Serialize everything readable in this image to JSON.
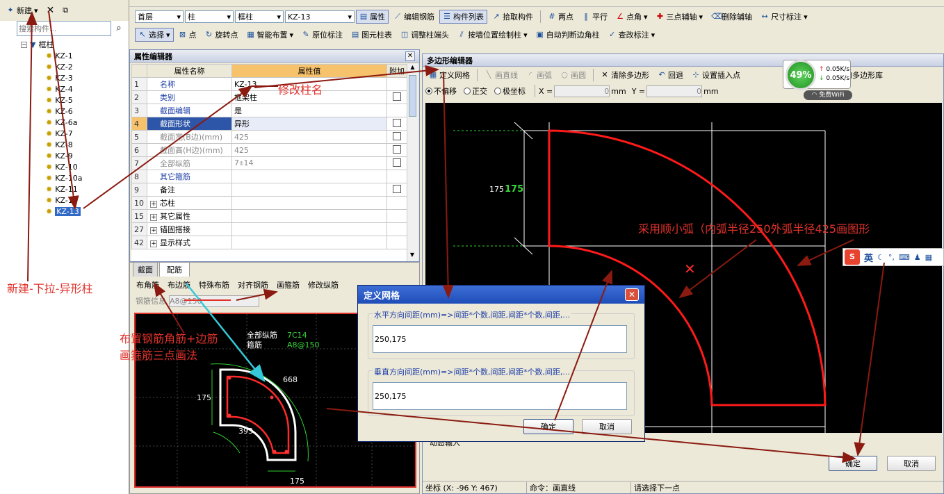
{
  "left_panel": {
    "new_label": "新建",
    "search_placeholder": "搜索构件...",
    "tree_root": "框柱",
    "items": [
      "KZ-1",
      "KZ-2",
      "KZ-3",
      "KZ-4",
      "KZ-5",
      "KZ-6",
      "KZ-6a",
      "KZ-7",
      "KZ-8",
      "KZ-9",
      "KZ-10",
      "KZ-10a",
      "KZ-11",
      "KZ-12",
      "KZ-13"
    ],
    "selected": "KZ-13"
  },
  "toolbar1": {
    "floor": "首层",
    "type": "柱",
    "subtype": "框柱",
    "component": "KZ-13",
    "attr_btn": "属性",
    "edit_rebar": "编辑钢筋",
    "component_list": "构件列表",
    "pick_component": "拾取构件",
    "two_points": "两点",
    "parallel": "平行",
    "point_angle": "点角",
    "three_point_axis": "三点辅轴",
    "delete_axis": "删除辅轴",
    "dimension": "尺寸标注"
  },
  "toolbar2": {
    "select": "选择",
    "point": "点",
    "rotate_point": "旋转点",
    "smart_layout": "智能布置",
    "origin_mark": "原位标注",
    "element_table": "图元柱表",
    "adjust_end": "调整柱端头",
    "wall_draw": "按墙位置绘制柱",
    "auto_corner": "自动判断边角柱",
    "check_mark": "查改标注"
  },
  "prop_editor": {
    "title": "属性编辑器",
    "col_name": "属性名称",
    "col_value": "属性值",
    "col_extra": "附加",
    "rows": [
      {
        "n": "1",
        "name": "名称",
        "value": "KZ-13",
        "style": "blue",
        "chk": false
      },
      {
        "n": "2",
        "name": "类别",
        "value": "框架柱",
        "style": "blue",
        "chk": true
      },
      {
        "n": "3",
        "name": "截面编辑",
        "value": "是",
        "style": "blue",
        "chk": false
      },
      {
        "n": "4",
        "name": "截面形状",
        "value": "异形",
        "style": "sel",
        "chk": true
      },
      {
        "n": "5",
        "name": "截面宽(B边)(mm)",
        "value": "425",
        "style": "gray",
        "chk": true
      },
      {
        "n": "6",
        "name": "截面高(H边)(mm)",
        "value": "425",
        "style": "gray",
        "chk": true
      },
      {
        "n": "7",
        "name": "全部纵筋",
        "value": "7⌽14",
        "style": "gray",
        "chk": true
      },
      {
        "n": "8",
        "name": "其它箍筋",
        "value": "",
        "style": "blue",
        "chk": false
      },
      {
        "n": "9",
        "name": "备注",
        "value": "",
        "style": "",
        "chk": true
      },
      {
        "n": "10",
        "name": "芯柱",
        "value": "",
        "style": "plus",
        "chk": false
      },
      {
        "n": "15",
        "name": "其它属性",
        "value": "",
        "style": "plus",
        "chk": false
      },
      {
        "n": "27",
        "name": "锚固搭接",
        "value": "",
        "style": "plus",
        "chk": false
      },
      {
        "n": "42",
        "name": "显示样式",
        "value": "",
        "style": "plus",
        "chk": false
      }
    ]
  },
  "section": {
    "tab1": "截面",
    "tab2": "配筋",
    "corner": "布角筋",
    "edge": "布边筋",
    "special": "特殊布筋",
    "align": "对齐钢筋",
    "stirrup": "画箍筋",
    "modify": "修改纵筋",
    "rebar_info_label": "钢筋信息",
    "rebar_info_value": "A8@150",
    "label_all": "全部纵筋",
    "label_all_val": "7C14",
    "label_stirrup": "箍筋",
    "label_stirrup_val": "A8@150",
    "dim_175a": "175",
    "dim_668": "668",
    "dim_393": "393",
    "dim_175b": "175"
  },
  "poly_editor": {
    "title": "多边形编辑器",
    "define_grid": "定义网格",
    "draw_line": "画直线",
    "draw_arc": "画弧",
    "draw_circle": "画圆",
    "clear_poly": "清除多边形",
    "undo": "回退",
    "set_insert": "设置插入点",
    "query_lib": "查询多边形库",
    "no_offset": "不偏移",
    "orthogonal": "正交",
    "polar": "极坐标",
    "x_label": "X =",
    "x_value": "0",
    "x_unit": "mm",
    "y_label": "Y =",
    "y_value": "0",
    "y_unit": "mm",
    "dim_175": "175",
    "dim_175b": "175",
    "dynamic_input": "动态输入",
    "ok": "确定",
    "cancel": "取消",
    "coord": "坐标 (X: -96 Y: 467)",
    "command": "命令：画直线",
    "prompt": "请选择下一点"
  },
  "net_widget": {
    "percent": "49%",
    "up": "0.05K/s",
    "down": "0.05K/s",
    "wifi": "免费WiFi"
  },
  "ime": {
    "mode": "英"
  },
  "grid_dialog": {
    "title": "定义网格",
    "h_label": "水平方向间距(mm)=>间距*个数,间距,间距*个数,间距,...",
    "h_value": "250,175",
    "v_label": "垂直方向间距(mm)=>间距*个数,间距,间距*个数,间距,...",
    "v_value": "250,175",
    "ok": "确定",
    "cancel": "取消"
  },
  "annotations": {
    "rename": "修改柱名",
    "new_note": "新建-下拉-异形柱",
    "arc_note": "采用顺小弧（内弧半径250外弧半径425画图形",
    "rebar_note1": "布置钢筋角筋+边筋",
    "rebar_note2": "画箍筋三点画法"
  },
  "colors": {
    "accent_red": "#e0322b",
    "arrow": "#8b1a10",
    "cyan_arrow": "#35c8d8",
    "green_text": "#39d639"
  }
}
